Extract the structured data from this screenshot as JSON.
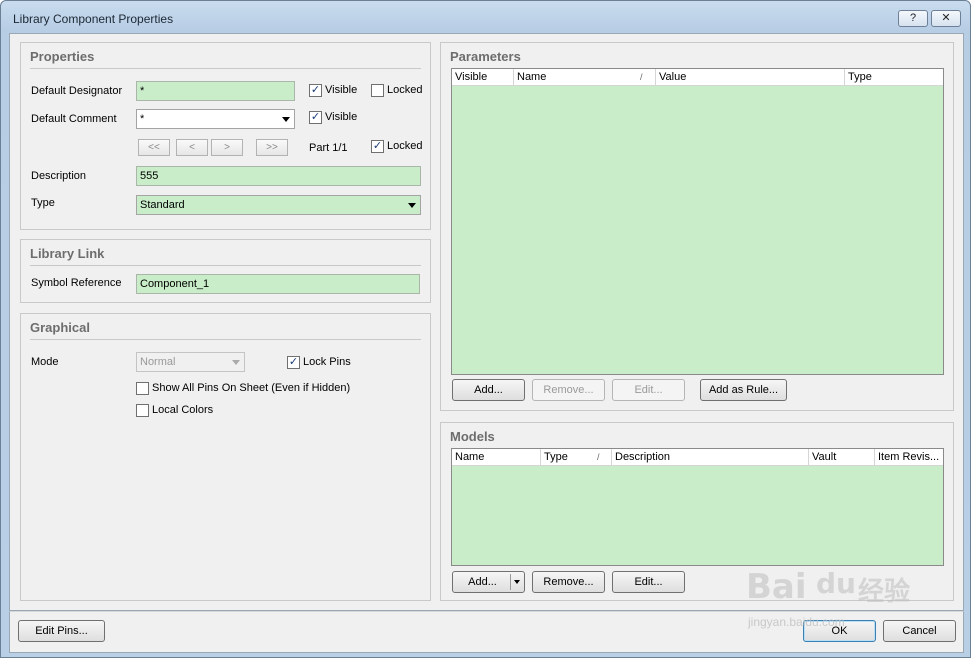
{
  "window": {
    "title": "Library Component Properties",
    "help_label": "?",
    "close_label": "✕"
  },
  "properties": {
    "title": "Properties",
    "default_designator_label": "Default Designator",
    "default_designator_value": "*",
    "default_comment_label": "Default Comment",
    "default_comment_value": "*",
    "visible_label": "Visible",
    "locked_label": "Locked",
    "nav": {
      "first": "<<",
      "prev": "<",
      "next": ">",
      "last": ">>"
    },
    "part_label": "Part 1/1",
    "description_label": "Description",
    "description_value": "555",
    "type_label": "Type",
    "type_value": "Standard",
    "designator_visible": true,
    "designator_locked": false,
    "comment_visible": true,
    "part_locked": true
  },
  "library_link": {
    "title": "Library Link",
    "symbol_reference_label": "Symbol Reference",
    "symbol_reference_value": "Component_1"
  },
  "graphical": {
    "title": "Graphical",
    "mode_label": "Mode",
    "mode_value": "Normal",
    "lock_pins_label": "Lock Pins",
    "lock_pins": true,
    "show_all_pins_label": "Show All Pins On Sheet (Even if Hidden)",
    "show_all_pins": false,
    "local_colors_label": "Local Colors",
    "local_colors": false
  },
  "parameters": {
    "title": "Parameters",
    "columns": [
      "Visible",
      "Name",
      "Value",
      "Type"
    ],
    "sort_mark": "/",
    "rows": [],
    "buttons": {
      "add": "Add...",
      "remove": "Remove...",
      "edit": "Edit...",
      "add_as_rule": "Add as Rule..."
    }
  },
  "models": {
    "title": "Models",
    "columns": [
      "Name",
      "Type",
      "Description",
      "Vault",
      "Item Revis..."
    ],
    "sort_mark": "/",
    "rows": [],
    "buttons": {
      "add": "Add...",
      "remove": "Remove...",
      "edit": "Edit..."
    }
  },
  "footer": {
    "edit_pins": "Edit Pins...",
    "ok": "OK",
    "cancel": "Cancel"
  },
  "watermark": {
    "brand": "Bai",
    "brand2": "du",
    "cn": "经验",
    "url": "jingyan.baidu.com"
  },
  "colors": {
    "grid_fill": "#c9ecc9",
    "panel_bg": "#f0f0f0",
    "title_bar": "#c9dcef"
  }
}
